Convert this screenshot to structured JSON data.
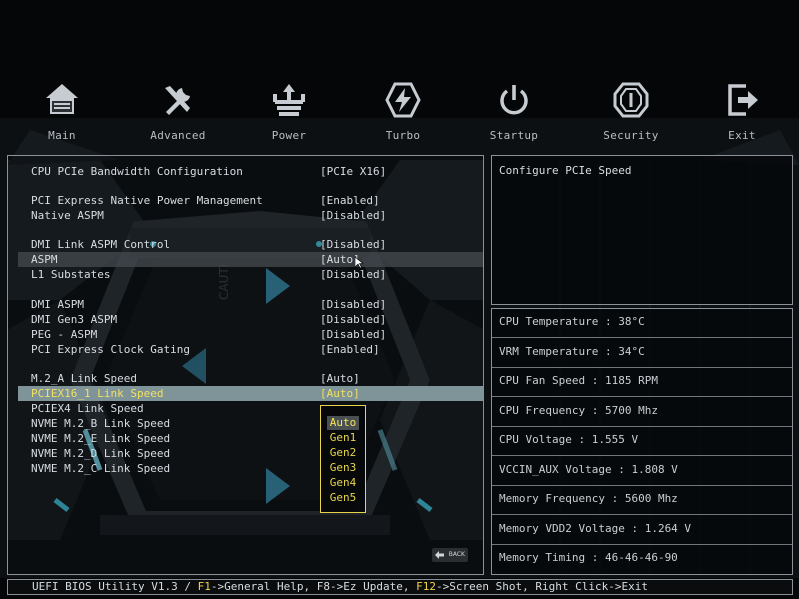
{
  "nav": [
    {
      "label": "Main",
      "icon": "home-icon"
    },
    {
      "label": "Advanced",
      "icon": "tools-icon"
    },
    {
      "label": "Power",
      "icon": "power-chip-icon"
    },
    {
      "label": "Turbo",
      "icon": "bolt-icon"
    },
    {
      "label": "Startup",
      "icon": "power-button-icon"
    },
    {
      "label": "Security",
      "icon": "shield-icon"
    },
    {
      "label": "Exit",
      "icon": "exit-icon"
    }
  ],
  "settings": [
    {
      "label": "CPU PCIe Bandwidth Configuration",
      "value": "[PCIe X16]"
    },
    {
      "label": "PCI Express Native Power Management",
      "value": "[Enabled]"
    },
    {
      "label": "Native ASPM",
      "value": "[Disabled]"
    },
    {
      "label": "DMI Link ASPM Control",
      "value": "[Disabled]"
    },
    {
      "label": "ASPM",
      "value": "[Auto]"
    },
    {
      "label": "L1 Substates",
      "value": "[Disabled]"
    },
    {
      "label": "DMI ASPM",
      "value": "[Disabled]"
    },
    {
      "label": "DMI Gen3 ASPM",
      "value": "[Disabled]"
    },
    {
      "label": "PEG - ASPM",
      "value": "[Disabled]"
    },
    {
      "label": "PCI Express Clock Gating",
      "value": "[Enabled]"
    },
    {
      "label": "M.2_A Link Speed",
      "value": "[Auto]"
    },
    {
      "label": "PCIEX16_1 Link Speed",
      "value": "[Auto]"
    },
    {
      "label": "PCIEX4 Link Speed",
      "value": ""
    },
    {
      "label": "NVME M.2_B Link Speed",
      "value": ""
    },
    {
      "label": "NVME M.2_E Link Speed",
      "value": ""
    },
    {
      "label": "NVME M.2_D Link Speed",
      "value": ""
    },
    {
      "label": "NVME M.2_C Link Speed",
      "value": ""
    }
  ],
  "dropdown": {
    "options": [
      "Auto",
      "Gen1",
      "Gen2",
      "Gen3",
      "Gen4",
      "Gen5"
    ],
    "selected": "Auto"
  },
  "help": {
    "text": "Configure PCIe Speed"
  },
  "hardware": [
    "CPU Temperature : 38°C",
    "VRM Temperature : 34°C",
    "CPU Fan Speed : 1185 RPM",
    "CPU Frequency : 5700 Mhz",
    "CPU Voltage : 1.555 V",
    "VCCIN_AUX Voltage : 1.808 V",
    "Memory Frequency : 5600 Mhz",
    "Memory VDD2 Voltage : 1.264 V",
    "Memory Timing : 46-46-46-90"
  ],
  "footer": {
    "prefix": "UEFI BIOS Utility V1.3 / ",
    "f1": "F1",
    "f1_text": "->General Help, F8->Ez Update, ",
    "f12": "F12",
    "f12_text": "->Screen Shot, Right Click->Exit"
  },
  "back_label": "BACK",
  "colors": {
    "accent": "#f2d44a",
    "highlight": "#7f9499",
    "border": "#8a9198",
    "glow": "#3fc6e0"
  }
}
